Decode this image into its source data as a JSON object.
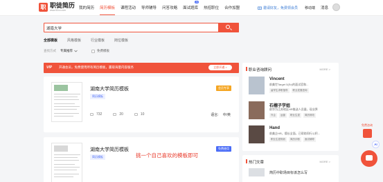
{
  "nav": {
    "logo_name": "职徒简历",
    "logo_url": "www.52cv.com",
    "links": [
      "我的简历",
      "简历模板",
      "课程活动",
      "导师辅导",
      "问答攻略",
      "面试题库",
      "热招职位",
      "合作加盟"
    ],
    "ai_badge": "AI",
    "promo": "邀请好友，免费领会员",
    "phone": "移动端",
    "messages": "消息"
  },
  "search": {
    "value": "湖南大学"
  },
  "filter_tabs": [
    "全部模板",
    "风格模板",
    "行业模板",
    "岗位模板"
  ],
  "filter_row": {
    "label": "查找方式",
    "sort": "专属推荐",
    "vip_only": "免费模板"
  },
  "banner": {
    "vip": "VIP",
    "text": "开通会员，免费使用所有简历模板，赢取海量内容服务",
    "button": "立即开通 >"
  },
  "cards": [
    {
      "title": "湖南大学简历模板",
      "tag": "简历模板",
      "badge": "会员专享",
      "badge_color": "#f5a623",
      "views": "732",
      "likes": "20",
      "favorites": "10",
      "language_label": "语言:",
      "language": "中/英"
    },
    {
      "title": "湖南大学简历模板",
      "tag": "简历模板",
      "badge": "免费使用",
      "badge_color": "#4a6cf7"
    }
  ],
  "overlay_note": "挑一个自己喜欢的模板即可",
  "advisors": {
    "title": "职业咨询顾问",
    "more": "MORE >",
    "items": [
      {
        "name": "Vincent",
        "desc": "前美世Target 5(Sr)的面试官和...",
        "tags": [
          "留学生求职指导",
          "职业发展咨询"
        ]
      },
      {
        "name": "石榴子学姐",
        "desc": "前华为江苏地区HR推送人员量，现业界",
        "tags": [
          "外企",
          "运营",
          "职业生涯",
          "简历修改"
        ]
      },
      {
        "name": "Hand",
        "desc": "前美企HR，擅长全面，已帮助同行公积...",
        "tags": [
          "职业生涯规划",
          "简历诊断",
          "面试辅导"
        ]
      }
    ]
  },
  "articles": {
    "title": "热门文章",
    "more": "MORE >",
    "first": "简历中职场目标该怎么写"
  },
  "floating": {
    "ai": "AI",
    "gift": "免费咨询"
  },
  "colors": {
    "accent": "#f0533b",
    "link_blue": "#3a7bd5"
  }
}
